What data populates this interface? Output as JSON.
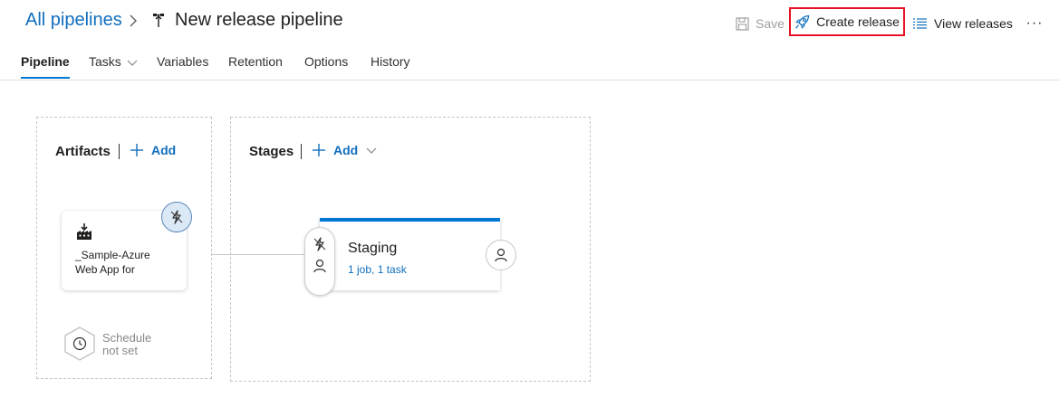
{
  "header": {
    "breadcrumb": "All pipelines",
    "title": "New release pipeline",
    "save_label": "Save",
    "create_release_label": "Create release",
    "view_releases_label": "View releases",
    "more_label": "···"
  },
  "tabs": [
    {
      "label": "Pipeline",
      "active": true
    },
    {
      "label": "Tasks"
    },
    {
      "label": "Variables"
    },
    {
      "label": "Retention"
    },
    {
      "label": "Options"
    },
    {
      "label": "History"
    }
  ],
  "artifacts": {
    "title": "Artifacts",
    "add_label": "Add",
    "artifact_name_line1": "_Sample-Azure",
    "artifact_name_line2": "Web App for",
    "schedule_line1": "Schedule",
    "schedule_line2": "not set"
  },
  "stages": {
    "title": "Stages",
    "add_label": "Add",
    "stage_name": "Staging",
    "stage_summary": "1 job, 1 task"
  },
  "colors": {
    "accent": "#0078d4",
    "link": "#106ebe",
    "highlight_border": "#e81123"
  },
  "icons": [
    "chevron-right-icon",
    "pipeline-icon",
    "save-icon",
    "rocket-icon",
    "list-icon",
    "chevron-down-icon",
    "plus-icon",
    "build-artifact-icon",
    "trigger-icon",
    "person-icon",
    "clock-icon"
  ]
}
